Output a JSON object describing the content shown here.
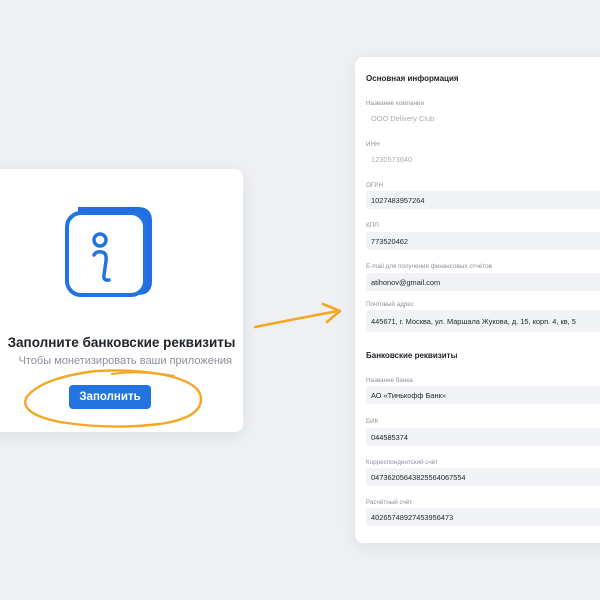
{
  "left_card": {
    "icon": "info-icon",
    "title": "Заполните банковские реквизиты",
    "subtitle": "Чтобы монетизировать ваши приложения",
    "button_label": "Заполнить"
  },
  "annotations": {
    "arrow": "arrow-right-icon",
    "highlight": "circle-highlight",
    "accent_color": "#f4a722"
  },
  "form": {
    "main_section": {
      "title": "Основная информация",
      "fields": [
        {
          "label": "Название компании",
          "value": "ООО Delivery Club",
          "disabled": true
        },
        {
          "label": "ИНН",
          "value": "1230573640",
          "disabled": true
        },
        {
          "label": "ОГРН",
          "value": "1027483957264",
          "disabled": false
        },
        {
          "label": "КПП",
          "value": "773520462",
          "disabled": false
        },
        {
          "label": "E-mail для получения финансовых отчётов",
          "value": "atihonov@gmail.com",
          "disabled": false
        },
        {
          "label": "Почтовый адрес",
          "value": "445671, г. Москва, ул. Маршала Жукова, д. 15, корп. 4, кв, 5",
          "disabled": false
        }
      ]
    },
    "bank_section": {
      "title": "Банковские реквизиты",
      "fields": [
        {
          "label": "Название банка",
          "value": "АО «Тинькофф Банк»",
          "disabled": false
        },
        {
          "label": "БИК",
          "value": "044585374",
          "disabled": false
        },
        {
          "label": "Корреспондентский счёт",
          "value": "04736205643825564067554",
          "disabled": false
        },
        {
          "label": "Расчётный счёт",
          "value": "40265748927453956473",
          "disabled": false
        }
      ]
    }
  },
  "colors": {
    "primary": "#2374e1",
    "background": "#eef0f4",
    "input_bg": "#f2f3f6"
  }
}
